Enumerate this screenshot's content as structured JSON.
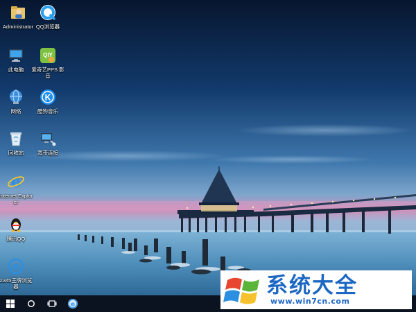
{
  "desktop": {
    "icons": [
      {
        "name": "administrator-folder",
        "label": "Administrator",
        "icon": "user-folder-icon"
      },
      {
        "name": "qq-browser",
        "label": "QQ浏览器",
        "icon": "qq-browser-icon"
      },
      {
        "name": "this-pc",
        "label": "此电脑",
        "icon": "computer-icon"
      },
      {
        "name": "iqiyi-pps",
        "label": "爱奇艺PPS 影音",
        "icon": "iqiyi-icon"
      },
      {
        "name": "network",
        "label": "网络",
        "icon": "network-globe-icon"
      },
      {
        "name": "kugou-music",
        "label": "酷狗音乐",
        "icon": "kugou-icon"
      },
      {
        "name": "recycle-bin",
        "label": "回收站",
        "icon": "recycle-bin-icon"
      },
      {
        "name": "broadband",
        "label": "宽带连接",
        "icon": "broadband-connection-icon"
      },
      {
        "name": "internet-explorer",
        "label": "Internet Explorer",
        "icon": "internet-explorer-icon"
      },
      {
        "name": "tencent-qq",
        "label": "腾讯QQ",
        "icon": "qq-penguin-icon"
      },
      {
        "name": "2345-browser",
        "label": "2345王牌浏览器",
        "icon": "2345-browser-icon"
      }
    ]
  },
  "taskbar": {
    "start": "windows-start-icon",
    "search": "cortana-circle-icon",
    "task_view": "task-view-icon",
    "pinned_browser": "2345-browser-taskbar-icon"
  },
  "watermark": {
    "title": "系统大全",
    "url": "www.win7cn.com",
    "logo": "windows-flag-logo",
    "brand_color": "#1d67c4"
  },
  "colors": {
    "sky_top": "#0a1c3d",
    "horizon_pink": "#d98fb6",
    "sea": "#5ea2c8",
    "taskbar": "#0b1220"
  }
}
